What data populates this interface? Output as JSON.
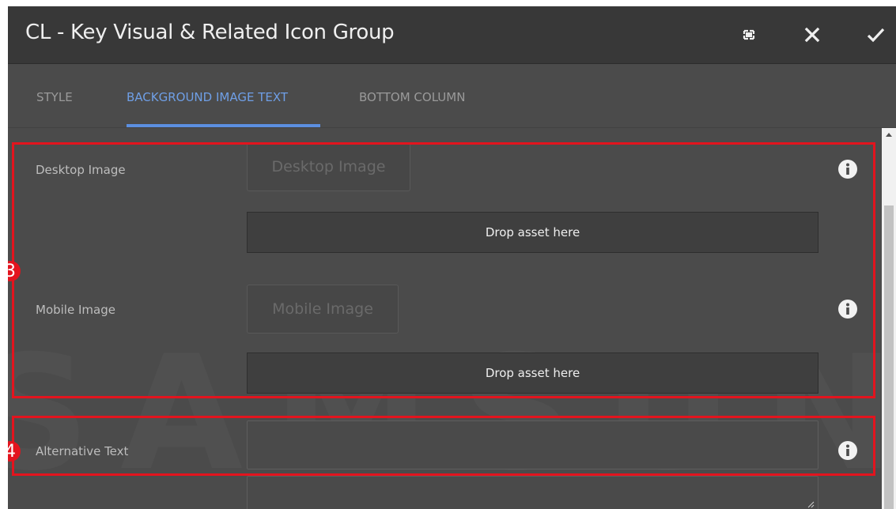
{
  "dialog": {
    "title": "CL - Key Visual & Related Icon Group",
    "actions": {
      "fullscreen_icon": "fullscreen-icon",
      "close_icon": "close-icon",
      "done_icon": "checkmark-icon"
    }
  },
  "tabs": [
    {
      "label": "STYLE",
      "active": false
    },
    {
      "label": "BACKGROUND IMAGE TEXT",
      "active": true
    },
    {
      "label": "BOTTOM COLUMN",
      "active": false
    }
  ],
  "fields": {
    "desktop_image": {
      "label": "Desktop Image",
      "button": "Desktop Image",
      "drop": "Drop asset here"
    },
    "mobile_image": {
      "label": "Mobile Image",
      "button": "Mobile Image",
      "drop": "Drop asset here"
    },
    "alternative_text": {
      "label": "Alternative Text",
      "value": ""
    }
  },
  "annotations": {
    "badge_3": "3",
    "badge_4": "4"
  },
  "colors": {
    "accent": "#5c8fe0",
    "highlight": "#e3141e",
    "dialog_bg": "#4b4b4b",
    "header_bg": "#383838"
  }
}
